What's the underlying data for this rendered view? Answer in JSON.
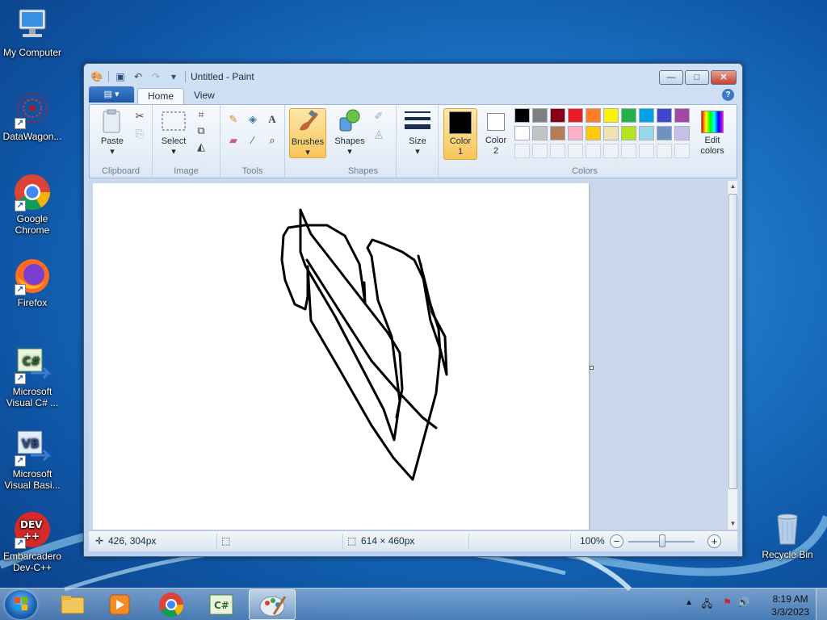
{
  "desktop": {
    "icons": [
      {
        "label": "My Computer"
      },
      {
        "label": "DataWagon..."
      },
      {
        "label": "Google Chrome"
      },
      {
        "label": "Firefox"
      },
      {
        "label": "Microsoft Visual C# ..."
      },
      {
        "label": "Microsoft Visual Basi..."
      },
      {
        "label": "Embarcadero Dev-C++"
      },
      {
        "label": "Recycle Bin"
      }
    ]
  },
  "window": {
    "title": "Untitled - Paint",
    "controls": {
      "minimize": "—",
      "maximize": "□",
      "close": "✕"
    },
    "tabs": [
      {
        "label": "Home"
      },
      {
        "label": "View"
      }
    ],
    "app_menu": "▤ ▾",
    "help": "?"
  },
  "ribbon": {
    "clipboard": {
      "paste": "Paste",
      "group": "Clipboard"
    },
    "image": {
      "select": "Select",
      "group": "Image"
    },
    "tools": {
      "group": "Tools"
    },
    "brushes": {
      "label": "Brushes"
    },
    "shapes": {
      "label": "Shapes",
      "group": "Shapes"
    },
    "size": {
      "label": "Size"
    },
    "colors": {
      "color1_line1": "Color",
      "color1_line2": "1",
      "color2_line1": "Color",
      "color2_line2": "2",
      "edit_line1": "Edit",
      "edit_line2": "colors",
      "group": "Colors",
      "color1": "#000000",
      "color2": "#ffffff",
      "palette_row1": [
        "#000000",
        "#7f7f7f",
        "#880015",
        "#ed1c24",
        "#ff7f27",
        "#fff200",
        "#22b14c",
        "#00a2e8",
        "#3f48cc",
        "#a349a4"
      ],
      "palette_row2": [
        "#ffffff",
        "#c3c3c3",
        "#b97a57",
        "#ffaec9",
        "#ffc90e",
        "#efe4b0",
        "#b5e61d",
        "#99d9ea",
        "#7092be",
        "#c8bfe7"
      ]
    }
  },
  "statusbar": {
    "cursor_pos": "426, 304px",
    "canvas_size": "614 × 460px",
    "zoom": "100%"
  },
  "taskbar": {
    "time": "8:19 AM",
    "date": "3/3/2023"
  }
}
